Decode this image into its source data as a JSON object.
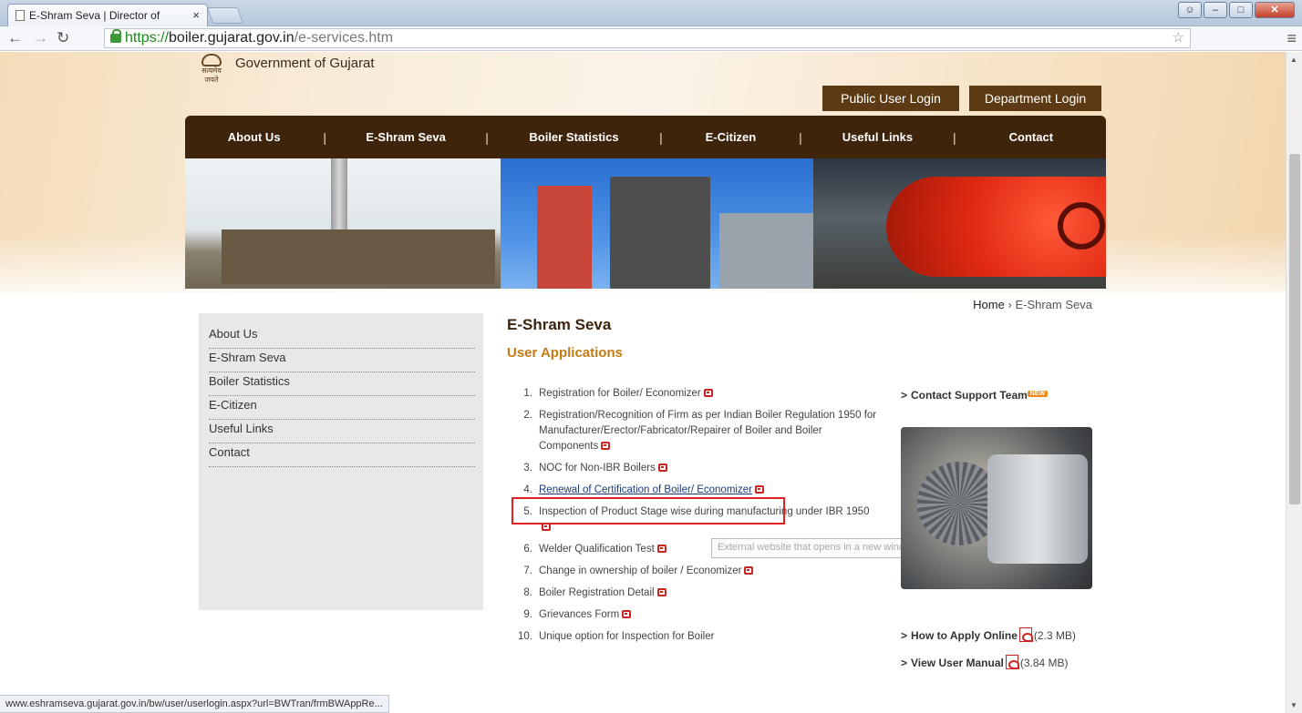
{
  "browser": {
    "tab_title": "E-Shram Seva | Director of",
    "tab_close": "×",
    "url_scheme": "https://",
    "url_host": "boiler.gujarat.gov.in",
    "url_path": "/e-services.htm",
    "status_url": "www.eshramseva.gujarat.gov.in/bw/user/userlogin.aspx?url=BWTran/frmBWAppRe..."
  },
  "header": {
    "title": "Government of Gujarat",
    "emblem_text": "सत्यमेव जयते",
    "public_login": "Public User Login",
    "department_login": "Department Login"
  },
  "nav": [
    "About Us",
    "E-Shram Seva",
    "Boiler Statistics",
    "E-Citizen",
    "Useful Links",
    "Contact"
  ],
  "nav_separator": "|",
  "breadcrumb": {
    "home": "Home",
    "separator": "›",
    "current": "E-Shram Seva"
  },
  "sidebar": [
    "About Us",
    "E-Shram Seva",
    "Boiler Statistics",
    "E-Citizen",
    "Useful Links",
    "Contact"
  ],
  "content": {
    "heading": "E-Shram Seva",
    "subheading": "User Applications",
    "applications": [
      {
        "num": "1.",
        "text": "Registration for Boiler/ Economizer"
      },
      {
        "num": "2.",
        "text": "Registration/Recognition of Firm as per Indian Boiler Regulation 1950 for Manufacturer/Erector/Fabricator/Repairer of Boiler and Boiler Components"
      },
      {
        "num": "3.",
        "text": "NOC for Non-IBR Boilers"
      },
      {
        "num": "4.",
        "text": "Renewal of Certification of Boiler/ Economizer"
      },
      {
        "num": "5.",
        "text": "Inspection of Product Stage wise during manufacturing under IBR 1950"
      },
      {
        "num": "6.",
        "text": "Welder Qualification Test"
      },
      {
        "num": "7.",
        "text": "Change in ownership of boiler / Economizer"
      },
      {
        "num": "8.",
        "text": "Boiler Registration Detail"
      },
      {
        "num": "9.",
        "text": "Grievances Form"
      },
      {
        "num": "10.",
        "text": "Unique option for Inspection for Boiler"
      }
    ],
    "tooltip": "External website that opens in a new window"
  },
  "right": {
    "support": "Contact Support Team",
    "new_badge": "NEW",
    "how_to_apply": "How to Apply Online",
    "how_to_apply_size": "(2.3 MB)",
    "user_manual": "View User Manual",
    "user_manual_size": "(3.84 MB)",
    "chevron": ">"
  },
  "icons": {
    "external_link": "external-link-icon",
    "pdf": "pdf-icon",
    "lock": "lock-icon"
  },
  "colors": {
    "nav_bg": "#3e240b",
    "login_bg": "#5c3a14",
    "heading": "#3b250c",
    "subheading": "#c77a12",
    "highlight": "#e02020"
  }
}
